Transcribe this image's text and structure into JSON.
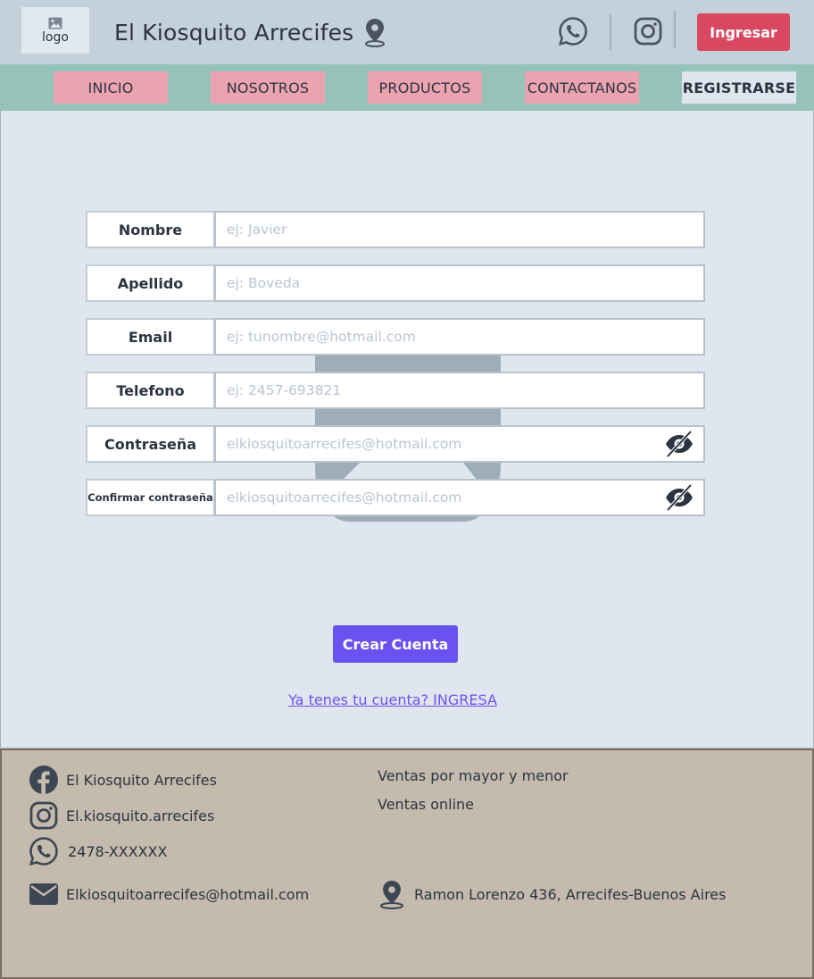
{
  "header": {
    "logo_label": "logo",
    "title": "El Kiosquito Arrecifes",
    "login_button": "Ingresar",
    "icons": [
      "image-icon",
      "map-pin-icon",
      "whatsapp-icon",
      "instagram-icon"
    ]
  },
  "nav": {
    "items": [
      "INICIO",
      "NOSOTROS",
      "PRODUCTOS",
      "CONTACTANOS",
      "REGISTRARSE"
    ]
  },
  "form": {
    "fields": [
      {
        "label": "Nombre",
        "placeholder": "ej: Javier",
        "value": ""
      },
      {
        "label": "Apellido",
        "placeholder": "ej: Boveda",
        "value": ""
      },
      {
        "label": "Email",
        "placeholder": "ej: tunombre@hotmail.com",
        "value": ""
      },
      {
        "label": "Telefono",
        "placeholder": "ej: 2457-693821",
        "value": ""
      },
      {
        "label": "Contraseña",
        "placeholder": "elkiosquitoarrecifes@hotmail.com",
        "value": ""
      },
      {
        "label": "Confirmar contraseña",
        "placeholder": "elkiosquitoarrecifes@hotmail.com",
        "value": ""
      }
    ],
    "submit_label": "Crear Cuenta",
    "login_link": "Ya tenes tu cuenta? INGRESA"
  },
  "footer": {
    "facebook": "El Kiosquito Arrecifes",
    "instagram": "El.kiosquito.arrecifes",
    "whatsapp": "2478-XXXXXX",
    "email": "Elkiosquitoarrecifes@hotmail.com",
    "sales_1": "Ventas por mayor y menor",
    "sales_2": "Ventas online",
    "address": "Ramon Lorenzo 436, Arrecifes-Buenos Aires"
  },
  "colors": {
    "header_bg": "#c4d0da",
    "nav_bg": "#96c3b8",
    "nav_item_bg": "#eba4af",
    "login_button": "#d94861",
    "primary": "#6a52f0",
    "footer_bg": "#c4baad"
  }
}
